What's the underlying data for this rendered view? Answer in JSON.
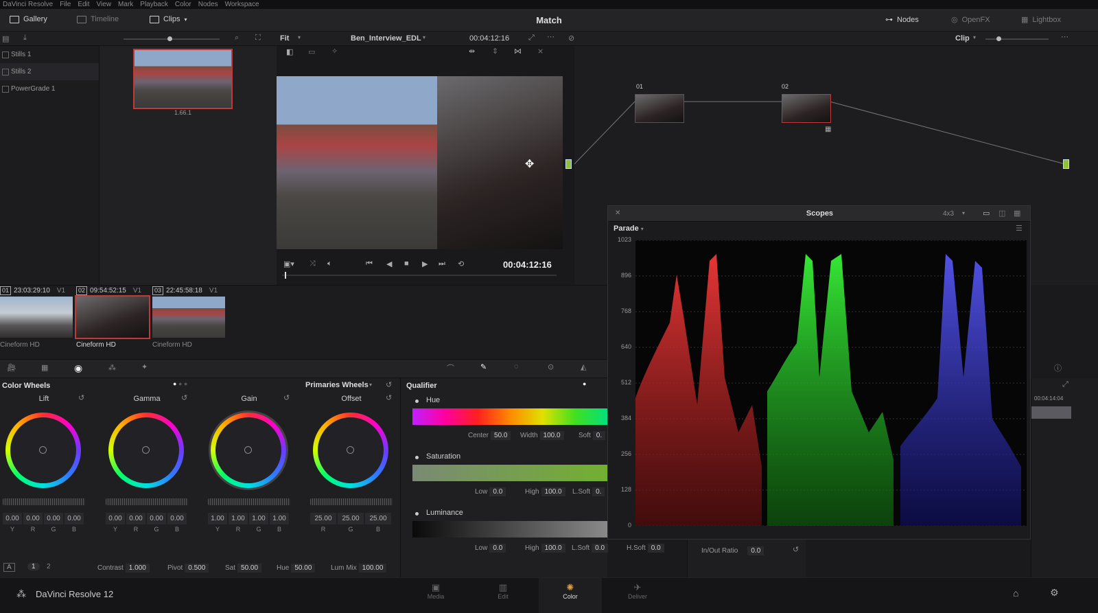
{
  "menu": [
    "DaVinci Resolve",
    "File",
    "Edit",
    "View",
    "Mark",
    "Playback",
    "Color",
    "Nodes",
    "Workspace"
  ],
  "toolbar": {
    "gallery": "Gallery",
    "timeline": "Timeline",
    "clips": "Clips",
    "title": "Match",
    "nodes": "Nodes",
    "openfx": "OpenFX",
    "lightbox": "Lightbox"
  },
  "subbar": {
    "fit": "Fit",
    "timeline_name": "Ben_Interview_EDL",
    "timecode": "00:04:12:16",
    "clip_mode": "Clip"
  },
  "sidebar": {
    "items": [
      "Stills 1",
      "Stills 2",
      "PowerGrade 1"
    ]
  },
  "gallery": {
    "still_label": "1.66.1"
  },
  "viewer": {
    "timecode": "00:04:12:16",
    "playhead_fraction": 0.01
  },
  "nodes": {
    "node1": "01",
    "node2": "02"
  },
  "clips": [
    {
      "num": "01",
      "tc": "23:03:29:10",
      "track": "V1",
      "name": "Cineform HD"
    },
    {
      "num": "02",
      "tc": "09:54:52:15",
      "track": "V1",
      "name": "Cineform HD"
    },
    {
      "num": "03",
      "tc": "22:45:58:18",
      "track": "V1",
      "name": "Cineform HD"
    }
  ],
  "colorwheels": {
    "title": "Color Wheels",
    "mode": "Primaries Wheels",
    "wheels": [
      {
        "label": "Lift",
        "values": [
          "0.00",
          "0.00",
          "0.00",
          "0.00"
        ],
        "chans": [
          "Y",
          "R",
          "G",
          "B"
        ]
      },
      {
        "label": "Gamma",
        "values": [
          "0.00",
          "0.00",
          "0.00",
          "0.00"
        ],
        "chans": [
          "Y",
          "R",
          "G",
          "B"
        ]
      },
      {
        "label": "Gain",
        "values": [
          "1.00",
          "1.00",
          "1.00",
          "1.00"
        ],
        "chans": [
          "Y",
          "R",
          "G",
          "B"
        ]
      },
      {
        "label": "Offset",
        "values": [
          "25.00",
          "25.00",
          "25.00"
        ],
        "chans": [
          "R",
          "G",
          "B"
        ]
      }
    ],
    "bottom": {
      "a": "A",
      "page1": "1",
      "page2": "2",
      "contrast_label": "Contrast",
      "contrast": "1.000",
      "pivot_label": "Pivot",
      "pivot": "0.500",
      "sat_label": "Sat",
      "sat": "50.00",
      "hue_label": "Hue",
      "hue": "50.00",
      "lummix_label": "Lum Mix",
      "lummix": "100.00"
    }
  },
  "qualifier": {
    "title": "Qualifier",
    "hue": "Hue",
    "hue_center_label": "Center",
    "hue_center": "50.0",
    "hue_width_label": "Width",
    "hue_width": "100.0",
    "hue_soft_label": "Soft",
    "hue_soft": "0.",
    "saturation": "Saturation",
    "sat_low_label": "Low",
    "sat_low": "0.0",
    "sat_high_label": "High",
    "sat_high": "100.0",
    "sat_lsoft_label": "L.Soft",
    "sat_lsoft": "0.",
    "luminance": "Luminance",
    "lum_low_label": "Low",
    "lum_low": "0.0",
    "lum_high_label": "High",
    "lum_high": "100.0",
    "lum_lsoft_label": "L.Soft",
    "lum_lsoft": "0.0",
    "lum_hsoft_label": "H.Soft",
    "lum_hsoft": "0.0",
    "inout_label": "In/Out Ratio",
    "inout": "0.0"
  },
  "scopes": {
    "title": "Scopes",
    "layout": "4x3",
    "type": "Parade",
    "ticks": [
      "1023",
      "896",
      "768",
      "640",
      "512",
      "384",
      "256",
      "128",
      "0"
    ]
  },
  "rightpanel": {
    "timecode": "00:04:14:04"
  },
  "statusbar": {
    "app": "DaVinci Resolve 12",
    "pages": [
      "Media",
      "Edit",
      "Color",
      "Deliver"
    ]
  },
  "colors": {
    "accent_red": "#c03a3a",
    "node_green": "#8fc03a"
  }
}
